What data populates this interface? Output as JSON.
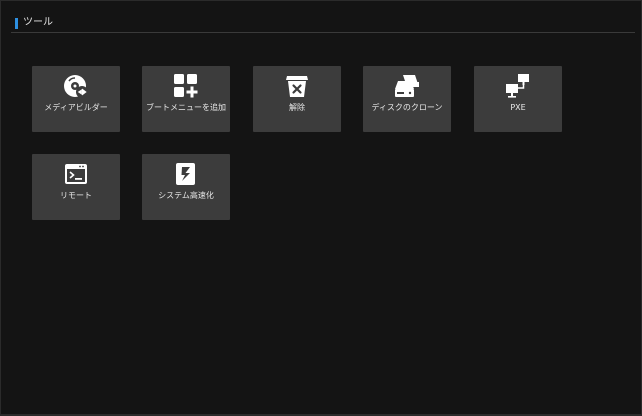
{
  "section": {
    "title": "ツール",
    "accent_color": "#2d8fe0"
  },
  "tools": [
    {
      "label": "メディアビルダー",
      "icon": "media-builder-disc-icon"
    },
    {
      "label": "ブートメニューを追加",
      "icon": "add-boot-menu-icon"
    },
    {
      "label": "解除",
      "icon": "release-box-x-icon"
    },
    {
      "label": "ディスクのクローン",
      "icon": "disk-clone-icon"
    },
    {
      "label": "PXE",
      "icon": "pxe-network-icon"
    },
    {
      "label": "リモート",
      "icon": "remote-terminal-icon"
    },
    {
      "label": "システム高速化",
      "icon": "system-speedup-icon"
    }
  ]
}
